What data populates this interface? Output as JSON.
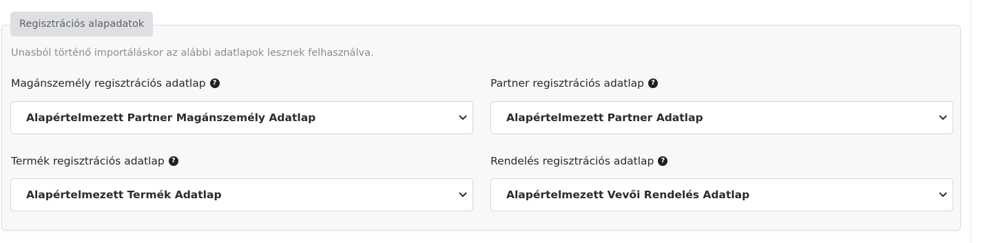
{
  "fieldset": {
    "legend": "Regisztrációs alapadatok",
    "hint": "Unasból történő importáláskor az alábbi adatlapok lesznek felhasználva."
  },
  "fields": [
    {
      "label": "Magánszemély regisztrációs adatlap",
      "selected": "Alapértelmezett Partner Magánszemély Adatlap"
    },
    {
      "label": "Partner regisztrációs adatlap",
      "selected": "Alapértelmezett Partner Adatlap"
    },
    {
      "label": "Termék regisztrációs adatlap",
      "selected": "Alapértelmezett Termék Adatlap"
    },
    {
      "label": "Rendelés regisztrációs adatlap",
      "selected": "Alapértelmezett Vevői Rendelés Adatlap"
    }
  ],
  "icons": {
    "help": "question-circle-icon",
    "dropdown": "chevron-down-icon"
  },
  "colors": {
    "panel_background": "#f8f8f9",
    "legend_background": "#dedfe3",
    "hint_text": "#8a8c94",
    "label_text": "#26282e"
  }
}
